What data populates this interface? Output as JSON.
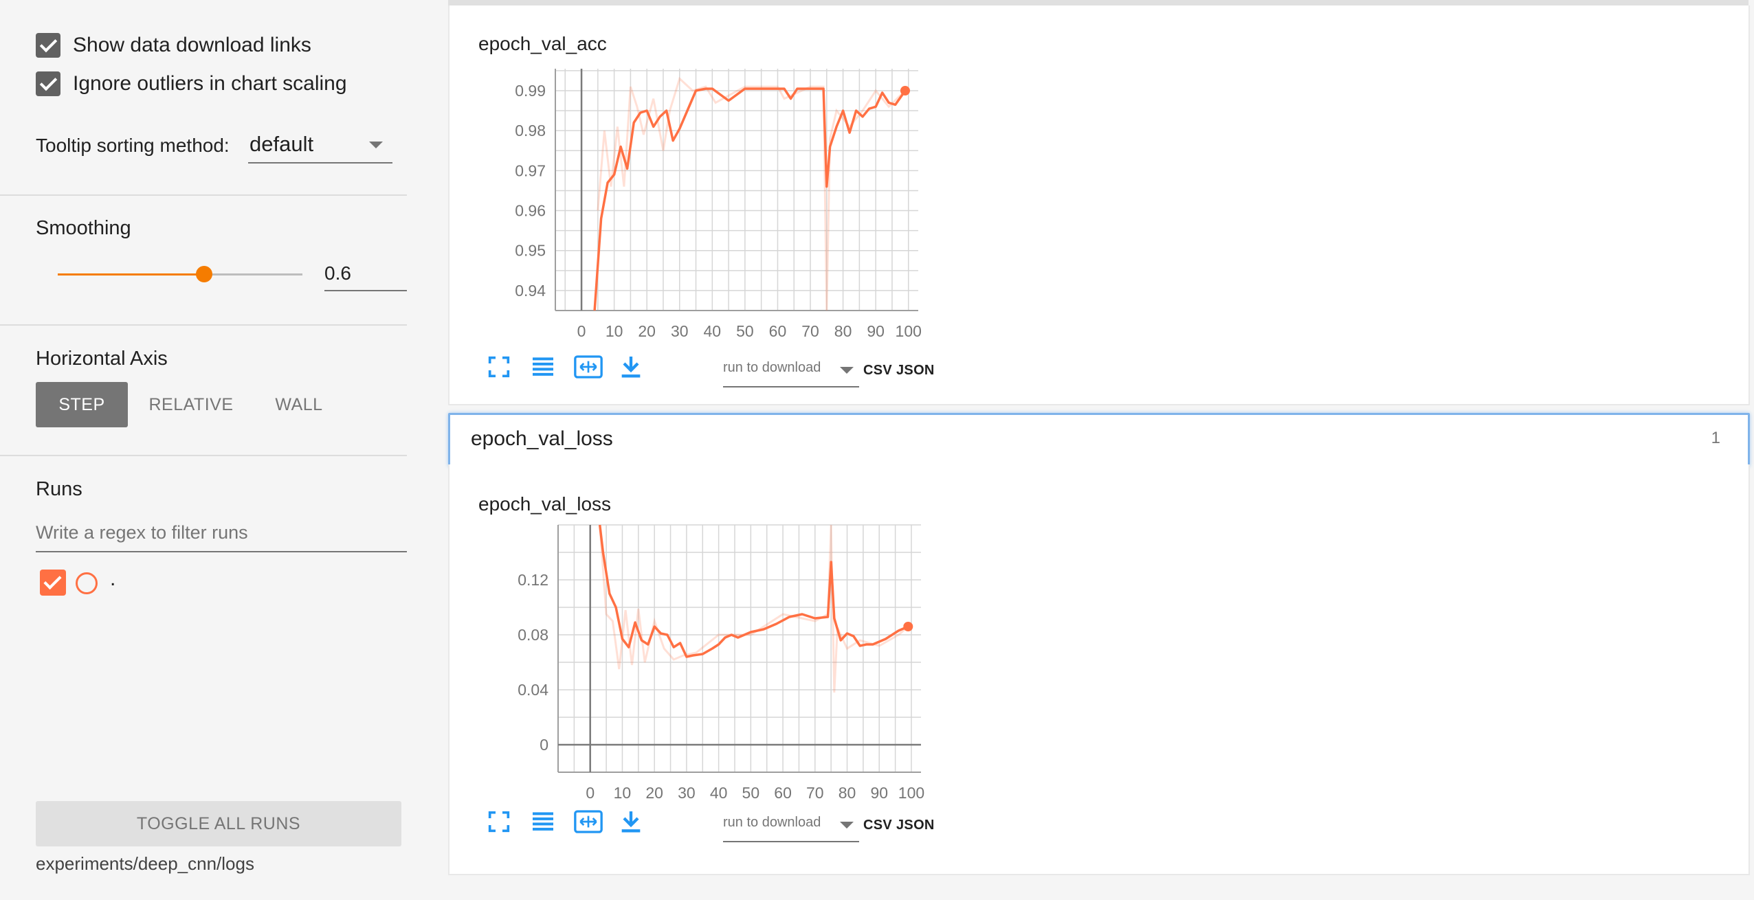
{
  "sidebar": {
    "show_download_links": "Show data download links",
    "ignore_outliers": "Ignore outliers in chart scaling",
    "tooltip_sorting_label": "Tooltip sorting method:",
    "tooltip_sorting_value": "default",
    "smoothing_label": "Smoothing",
    "smoothing_value": "0.6",
    "smoothing_fraction": 0.6,
    "horizontal_axis_label": "Horizontal Axis",
    "axis_options": [
      "STEP",
      "RELATIVE",
      "WALL"
    ],
    "axis_selected": "STEP",
    "runs_label": "Runs",
    "runs_filter_placeholder": "Write a regex to filter runs",
    "runs": [
      {
        "name": ".",
        "checked": true,
        "color": "#ff7043"
      }
    ],
    "toggle_all_runs": "TOGGLE ALL RUNS",
    "log_dir": "experiments/deep_cnn/logs"
  },
  "main": {
    "group_header": {
      "title": "epoch_val_loss",
      "count": "1"
    },
    "download_select_placeholder": "run to download",
    "csv_label": "CSV",
    "json_label": "JSON"
  },
  "colors": {
    "accent": "#f57c00",
    "run": "#ff7043",
    "icon_blue": "#2196f3",
    "selection_border": "#7fb3ea"
  },
  "icons": [
    "fullscreen-icon",
    "lines-icon",
    "fit-domain-icon",
    "download-icon"
  ],
  "chart_data": [
    {
      "type": "line",
      "title": "epoch_val_acc",
      "xlabel": "",
      "ylabel": "",
      "xlim": [
        -8,
        103
      ],
      "ylim": [
        0.935,
        0.9955
      ],
      "x_ticks": [
        0,
        10,
        20,
        30,
        40,
        50,
        60,
        70,
        80,
        90,
        100
      ],
      "y_ticks": [
        0.94,
        0.95,
        0.96,
        0.97,
        0.98,
        0.99
      ],
      "grid": true,
      "smoothed": {
        "x": [
          4,
          6,
          8,
          10,
          12,
          14,
          16,
          18,
          20,
          22,
          24,
          26,
          28,
          30,
          35,
          38,
          40,
          45,
          50,
          55,
          60,
          62,
          64,
          66,
          70,
          74,
          75,
          76,
          78,
          80,
          82,
          84,
          86,
          88,
          90,
          92,
          94,
          96,
          99
        ],
        "y": [
          0.935,
          0.958,
          0.967,
          0.969,
          0.976,
          0.9705,
          0.982,
          0.9845,
          0.985,
          0.981,
          0.9835,
          0.985,
          0.9775,
          0.9805,
          0.99,
          0.9905,
          0.9905,
          0.9875,
          0.9905,
          0.9905,
          0.9905,
          0.9905,
          0.988,
          0.9905,
          0.9905,
          0.9905,
          0.966,
          0.976,
          0.981,
          0.985,
          0.9795,
          0.985,
          0.9835,
          0.9855,
          0.986,
          0.9895,
          0.987,
          0.9865,
          0.99
        ]
      },
      "raw": {
        "x": [
          5,
          7,
          9,
          11,
          13,
          15,
          17,
          19,
          22,
          25,
          27,
          30,
          34,
          38,
          41,
          50,
          60,
          62,
          70,
          74,
          75,
          76,
          78,
          82,
          86,
          90,
          94,
          99
        ],
        "y": [
          0.96,
          0.98,
          0.966,
          0.981,
          0.966,
          0.991,
          0.986,
          0.979,
          0.988,
          0.975,
          0.985,
          0.993,
          0.99,
          0.991,
          0.987,
          0.991,
          0.991,
          0.988,
          0.991,
          0.991,
          0.935,
          0.978,
          0.985,
          0.981,
          0.985,
          0.99,
          0.986,
          0.99
        ]
      }
    },
    {
      "type": "line",
      "title": "epoch_val_loss",
      "xlabel": "",
      "ylabel": "",
      "xlim": [
        -10,
        103
      ],
      "ylim": [
        -0.02,
        0.16
      ],
      "x_ticks": [
        0,
        10,
        20,
        30,
        40,
        50,
        60,
        70,
        80,
        90,
        100
      ],
      "y_ticks": [
        0,
        0.04,
        0.08,
        0.12
      ],
      "grid": true,
      "smoothed": {
        "x": [
          3,
          4,
          6,
          8,
          10,
          12,
          14,
          16,
          18,
          20,
          22,
          24,
          26,
          28,
          30,
          32,
          35,
          38,
          40,
          42,
          44,
          46,
          50,
          54,
          58,
          62,
          66,
          70,
          74,
          75,
          76,
          78,
          80,
          82,
          84,
          86,
          88,
          92,
          96,
          99
        ],
        "y": [
          0.16,
          0.14,
          0.11,
          0.1,
          0.077,
          0.071,
          0.089,
          0.076,
          0.073,
          0.086,
          0.081,
          0.08,
          0.071,
          0.074,
          0.064,
          0.065,
          0.066,
          0.07,
          0.073,
          0.078,
          0.08,
          0.078,
          0.082,
          0.084,
          0.088,
          0.093,
          0.095,
          0.092,
          0.093,
          0.133,
          0.092,
          0.076,
          0.081,
          0.079,
          0.072,
          0.073,
          0.073,
          0.077,
          0.083,
          0.086
        ]
      },
      "raw": {
        "x": [
          3,
          5,
          7,
          9,
          11,
          13,
          15,
          17,
          20,
          23,
          26,
          29,
          33,
          40,
          50,
          60,
          70,
          74,
          75,
          76,
          77,
          80,
          84,
          90,
          96,
          99
        ],
        "y": [
          0.16,
          0.095,
          0.09,
          0.055,
          0.098,
          0.058,
          0.099,
          0.06,
          0.09,
          0.07,
          0.062,
          0.065,
          0.067,
          0.08,
          0.08,
          0.095,
          0.09,
          0.095,
          0.16,
          0.038,
          0.085,
          0.07,
          0.076,
          0.072,
          0.08,
          0.086
        ]
      }
    }
  ]
}
